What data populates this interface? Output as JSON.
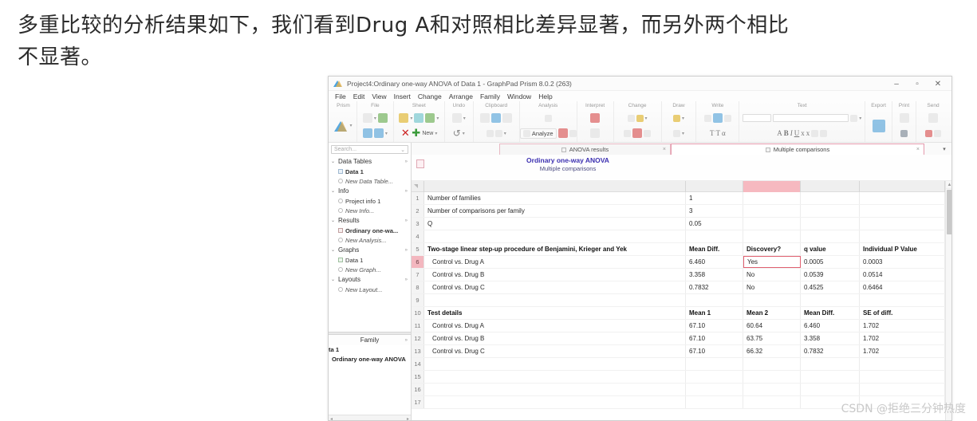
{
  "caption": {
    "text": "多重比较的分析结果如下，我们看到Drug A和对照相比差异显著，而另外两个相比\n不显著。"
  },
  "watermark": {
    "text": "CSDN @拒绝三分钟热度"
  },
  "window": {
    "title": "Project4:Ordinary one-way ANOVA of Data 1 - GraphPad Prism 8.0.2 (263)",
    "controls": {
      "minimize": "–",
      "maximize": "▫",
      "close": "✕"
    },
    "menu": [
      "File",
      "Edit",
      "View",
      "Insert",
      "Change",
      "Arrange",
      "Family",
      "Window",
      "Help"
    ],
    "ribbon_groups": [
      {
        "label": "Prism"
      },
      {
        "label": "File"
      },
      {
        "label": "Sheet"
      },
      {
        "label": "Undo"
      },
      {
        "label": "Clipboard"
      },
      {
        "label": "Analysis",
        "analyze_label": "Analyze"
      },
      {
        "label": "Interpret"
      },
      {
        "label": "Change"
      },
      {
        "label": "Draw"
      },
      {
        "label": "Write"
      },
      {
        "label": "Text"
      },
      {
        "label": "Export"
      },
      {
        "label": "Print"
      },
      {
        "label": "Send"
      }
    ],
    "ribbon_text_buttons": {
      "new": "New",
      "t1": "T",
      "t2": "T",
      "alpha": "α",
      "A": "A",
      "B": "B",
      "I": "I",
      "U": "U",
      "x1": "x",
      "x2": "x"
    }
  },
  "navigator": {
    "search_placeholder": "Search...",
    "sections": [
      {
        "label": "Data Tables",
        "items": [
          {
            "label": "Data 1",
            "style": "bold",
            "icon": "table-icon"
          },
          {
            "label": "New Data Table...",
            "style": "italic",
            "icon": "new-icon"
          }
        ]
      },
      {
        "label": "Info",
        "items": [
          {
            "label": "Project info 1",
            "style": "normal",
            "icon": "info-icon"
          },
          {
            "label": "New Info...",
            "style": "italic",
            "icon": "new-icon"
          }
        ]
      },
      {
        "label": "Results",
        "items": [
          {
            "label": "Ordinary one-wa...",
            "style": "bold",
            "icon": "results-icon"
          },
          {
            "label": "New Analysis...",
            "style": "italic",
            "icon": "new-icon"
          }
        ]
      },
      {
        "label": "Graphs",
        "items": [
          {
            "label": "Data 1",
            "style": "normal",
            "icon": "graph-icon"
          },
          {
            "label": "New Graph...",
            "style": "italic",
            "icon": "new-icon"
          }
        ]
      },
      {
        "label": "Layouts",
        "items": [
          {
            "label": "New Layout...",
            "style": "italic",
            "icon": "new-icon"
          }
        ]
      }
    ],
    "family": {
      "header": "Family",
      "rows": [
        "ta 1",
        "Ordinary one-way ANOVA"
      ]
    }
  },
  "tabs": [
    {
      "label": "ANOVA results",
      "active": false,
      "close": "×"
    },
    {
      "label": "Multiple comparisons",
      "active": true,
      "close": "×"
    }
  ],
  "tab_menu_icon": "▾",
  "sheet": {
    "title": "Ordinary one-way ANOVA",
    "subtitle": "Multiple comparisons"
  },
  "table": {
    "headers": [
      "",
      "Mean Diff.",
      "Discovery?",
      "q value",
      "Individual P Value"
    ],
    "rows": [
      {
        "n": "1",
        "name": "Number of families",
        "bold": false,
        "indent": false,
        "a": "1",
        "b": "",
        "c": "",
        "d": ""
      },
      {
        "n": "2",
        "name": "Number of comparisons per family",
        "bold": false,
        "indent": false,
        "a": "3",
        "b": "",
        "c": "",
        "d": ""
      },
      {
        "n": "3",
        "name": "Q",
        "bold": false,
        "indent": false,
        "a": "0.05",
        "b": "",
        "c": "",
        "d": ""
      },
      {
        "n": "4",
        "name": "",
        "bold": false,
        "indent": false,
        "a": "",
        "b": "",
        "c": "",
        "d": ""
      },
      {
        "n": "5",
        "name": "Two-stage linear step-up procedure of Benjamini, Krieger and Yek",
        "bold": true,
        "indent": false,
        "a": "Mean Diff.",
        "b": "Discovery?",
        "c": "q value",
        "d": "Individual P Value",
        "header_row": true
      },
      {
        "n": "6",
        "name": "Control  vs. Drug A",
        "bold": false,
        "indent": true,
        "a": "6.460",
        "b": "Yes",
        "c": "0.0005",
        "d": "0.0003",
        "selected": true
      },
      {
        "n": "7",
        "name": "Control  vs. Drug B",
        "bold": false,
        "indent": true,
        "a": "3.358",
        "b": "No",
        "c": "0.0539",
        "d": "0.0514"
      },
      {
        "n": "8",
        "name": "Control  vs. Drug C",
        "bold": false,
        "indent": true,
        "a": "0.7832",
        "b": "No",
        "c": "0.4525",
        "d": "0.6464"
      },
      {
        "n": "9",
        "name": "",
        "bold": false,
        "indent": false,
        "a": "",
        "b": "",
        "c": "",
        "d": ""
      },
      {
        "n": "10",
        "name": "Test details",
        "bold": true,
        "indent": false,
        "a": "Mean 1",
        "b": "Mean 2",
        "c": "Mean Diff.",
        "d": "SE of diff.",
        "header_row": true
      },
      {
        "n": "11",
        "name": "Control  vs. Drug A",
        "bold": false,
        "indent": true,
        "a": "67.10",
        "b": "60.64",
        "c": "6.460",
        "d": "1.702"
      },
      {
        "n": "12",
        "name": "Control  vs. Drug B",
        "bold": false,
        "indent": true,
        "a": "67.10",
        "b": "63.75",
        "c": "3.358",
        "d": "1.702"
      },
      {
        "n": "13",
        "name": "Control  vs. Drug C",
        "bold": false,
        "indent": true,
        "a": "67.10",
        "b": "66.32",
        "c": "0.7832",
        "d": "1.702"
      },
      {
        "n": "14",
        "name": "",
        "bold": false,
        "indent": false,
        "a": "",
        "b": "",
        "c": "",
        "d": ""
      },
      {
        "n": "15",
        "name": "",
        "bold": false,
        "indent": false,
        "a": "",
        "b": "",
        "c": "",
        "d": ""
      },
      {
        "n": "16",
        "name": "",
        "bold": false,
        "indent": false,
        "a": "",
        "b": "",
        "c": "",
        "d": ""
      },
      {
        "n": "17",
        "name": "",
        "bold": false,
        "indent": false,
        "a": "",
        "b": "",
        "c": "",
        "d": ""
      }
    ]
  },
  "colors": {
    "selection_pink": "#f3b7bf",
    "selection_border": "#e06070",
    "sheet_title_blue": "#3b2fb0",
    "tab_border_pink": "#e59aad"
  }
}
